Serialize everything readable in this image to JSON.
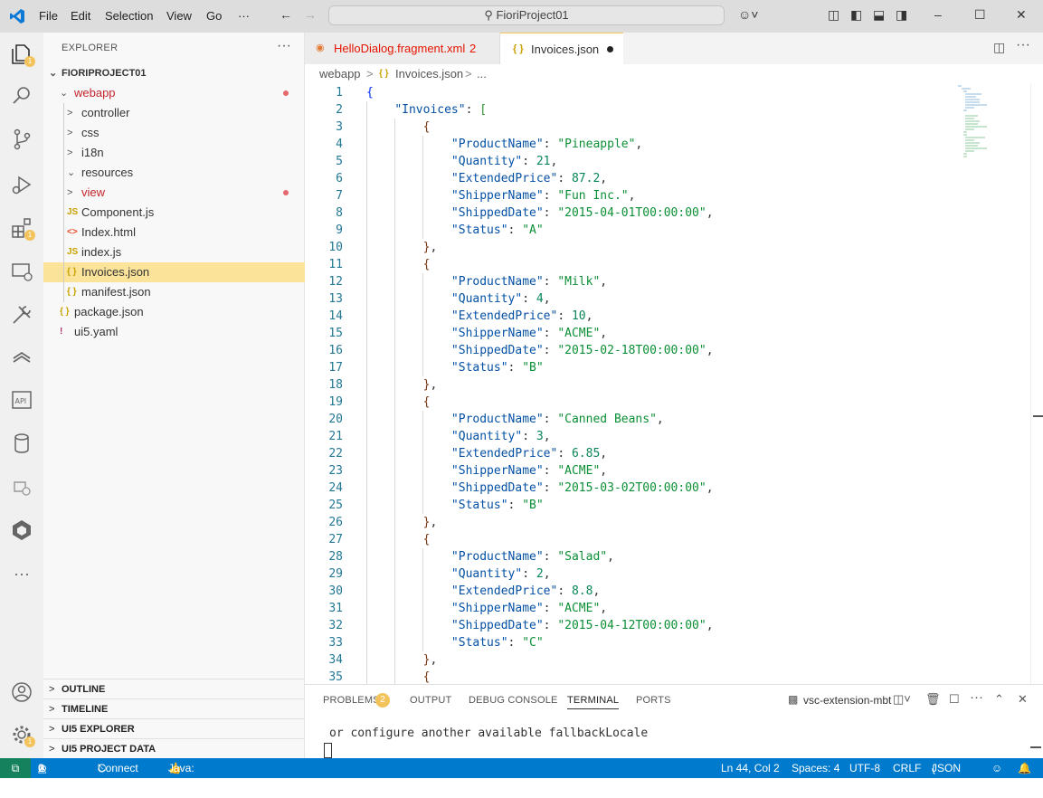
{
  "titlebar": {
    "menus": [
      "File",
      "Edit",
      "Selection",
      "View",
      "Go",
      "···"
    ],
    "search": "FioriProject01"
  },
  "sidebar": {
    "title": "EXPLORER",
    "project": "FIORIPROJECT01",
    "tree": [
      {
        "label": "webapp",
        "type": "folder-open",
        "depth": 1,
        "dot": true
      },
      {
        "label": "controller",
        "type": "folder",
        "depth": 2
      },
      {
        "label": "css",
        "type": "folder",
        "depth": 2
      },
      {
        "label": "i18n",
        "type": "folder",
        "depth": 2
      },
      {
        "label": "resources",
        "type": "folder-open",
        "depth": 2
      },
      {
        "label": "view",
        "type": "folder",
        "depth": 2,
        "dot": true
      },
      {
        "label": "Component.js",
        "type": "js",
        "depth": 2
      },
      {
        "label": "Index.html",
        "type": "html",
        "depth": 2
      },
      {
        "label": "index.js",
        "type": "js",
        "depth": 2
      },
      {
        "label": "Invoices.json",
        "type": "json",
        "depth": 2,
        "selected": true
      },
      {
        "label": "manifest.json",
        "type": "json",
        "depth": 2
      },
      {
        "label": "package.json",
        "type": "json",
        "depth": 1
      },
      {
        "label": "ui5.yaml",
        "type": "yaml",
        "depth": 1
      }
    ],
    "panels": [
      "OUTLINE",
      "TIMELINE",
      "UI5 EXPLORER",
      "UI5 PROJECT DATA"
    ]
  },
  "tabs": [
    {
      "label": "HelloDialog.fragment.xml",
      "badge": "2",
      "active": false
    },
    {
      "label": "Invoices.json",
      "active": true
    }
  ],
  "breadcrumb": {
    "folder": "webapp",
    "file": "Invoices.json",
    "more": "..."
  },
  "editor": {
    "start_line": 1,
    "lines": [
      [
        [
          "{",
          "b1"
        ]
      ],
      [
        [
          "    "
        ],
        [
          "\"Invoices\"",
          "k"
        ],
        [
          ": "
        ],
        [
          "[",
          "b2"
        ]
      ],
      [
        [
          "        "
        ],
        [
          "{",
          "b3"
        ]
      ],
      [
        [
          "            "
        ],
        [
          "\"ProductName\"",
          "k"
        ],
        [
          ": "
        ],
        [
          "\"Pineapple\"",
          "s"
        ],
        [
          ","
        ]
      ],
      [
        [
          "            "
        ],
        [
          "\"Quantity\"",
          "k"
        ],
        [
          ": "
        ],
        [
          "21",
          "n"
        ],
        [
          ","
        ]
      ],
      [
        [
          "            "
        ],
        [
          "\"ExtendedPrice\"",
          "k"
        ],
        [
          ": "
        ],
        [
          "87.2",
          "n"
        ],
        [
          ","
        ]
      ],
      [
        [
          "            "
        ],
        [
          "\"ShipperName\"",
          "k"
        ],
        [
          ": "
        ],
        [
          "\"Fun Inc.\"",
          "s"
        ],
        [
          ","
        ]
      ],
      [
        [
          "            "
        ],
        [
          "\"ShippedDate\"",
          "k"
        ],
        [
          ": "
        ],
        [
          "\"2015-04-01T00:00:00\"",
          "s"
        ],
        [
          ","
        ]
      ],
      [
        [
          "            "
        ],
        [
          "\"Status\"",
          "k"
        ],
        [
          ": "
        ],
        [
          "\"A\"",
          "s"
        ]
      ],
      [
        [
          "        "
        ],
        [
          "}",
          "b3"
        ],
        [
          ","
        ]
      ],
      [
        [
          "        "
        ],
        [
          "{",
          "b3"
        ]
      ],
      [
        [
          "            "
        ],
        [
          "\"ProductName\"",
          "k"
        ],
        [
          ": "
        ],
        [
          "\"Milk\"",
          "s"
        ],
        [
          ","
        ]
      ],
      [
        [
          "            "
        ],
        [
          "\"Quantity\"",
          "k"
        ],
        [
          ": "
        ],
        [
          "4",
          "n"
        ],
        [
          ","
        ]
      ],
      [
        [
          "            "
        ],
        [
          "\"ExtendedPrice\"",
          "k"
        ],
        [
          ": "
        ],
        [
          "10",
          "n"
        ],
        [
          ","
        ]
      ],
      [
        [
          "            "
        ],
        [
          "\"ShipperName\"",
          "k"
        ],
        [
          ": "
        ],
        [
          "\"ACME\"",
          "s"
        ],
        [
          ","
        ]
      ],
      [
        [
          "            "
        ],
        [
          "\"ShippedDate\"",
          "k"
        ],
        [
          ": "
        ],
        [
          "\"2015-02-18T00:00:00\"",
          "s"
        ],
        [
          ","
        ]
      ],
      [
        [
          "            "
        ],
        [
          "\"Status\"",
          "k"
        ],
        [
          ": "
        ],
        [
          "\"B\"",
          "s"
        ]
      ],
      [
        [
          "        "
        ],
        [
          "}",
          "b3"
        ],
        [
          ","
        ]
      ],
      [
        [
          "        "
        ],
        [
          "{",
          "b3"
        ]
      ],
      [
        [
          "            "
        ],
        [
          "\"ProductName\"",
          "k"
        ],
        [
          ": "
        ],
        [
          "\"Canned Beans\"",
          "s"
        ],
        [
          ","
        ]
      ],
      [
        [
          "            "
        ],
        [
          "\"Quantity\"",
          "k"
        ],
        [
          ": "
        ],
        [
          "3",
          "n"
        ],
        [
          ","
        ]
      ],
      [
        [
          "            "
        ],
        [
          "\"ExtendedPrice\"",
          "k"
        ],
        [
          ": "
        ],
        [
          "6.85",
          "n"
        ],
        [
          ","
        ]
      ],
      [
        [
          "            "
        ],
        [
          "\"ShipperName\"",
          "k"
        ],
        [
          ": "
        ],
        [
          "\"ACME\"",
          "s"
        ],
        [
          ","
        ]
      ],
      [
        [
          "            "
        ],
        [
          "\"ShippedDate\"",
          "k"
        ],
        [
          ": "
        ],
        [
          "\"2015-03-02T00:00:00\"",
          "s"
        ],
        [
          ","
        ]
      ],
      [
        [
          "            "
        ],
        [
          "\"Status\"",
          "k"
        ],
        [
          ": "
        ],
        [
          "\"B\"",
          "s"
        ]
      ],
      [
        [
          "        "
        ],
        [
          "}",
          "b3"
        ],
        [
          ","
        ]
      ],
      [
        [
          "        "
        ],
        [
          "{",
          "b3"
        ]
      ],
      [
        [
          "            "
        ],
        [
          "\"ProductName\"",
          "k"
        ],
        [
          ": "
        ],
        [
          "\"Salad\"",
          "s"
        ],
        [
          ","
        ]
      ],
      [
        [
          "            "
        ],
        [
          "\"Quantity\"",
          "k"
        ],
        [
          ": "
        ],
        [
          "2",
          "n"
        ],
        [
          ","
        ]
      ],
      [
        [
          "            "
        ],
        [
          "\"ExtendedPrice\"",
          "k"
        ],
        [
          ": "
        ],
        [
          "8.8",
          "n"
        ],
        [
          ","
        ]
      ],
      [
        [
          "            "
        ],
        [
          "\"ShipperName\"",
          "k"
        ],
        [
          ": "
        ],
        [
          "\"ACME\"",
          "s"
        ],
        [
          ","
        ]
      ],
      [
        [
          "            "
        ],
        [
          "\"ShippedDate\"",
          "k"
        ],
        [
          ": "
        ],
        [
          "\"2015-04-12T00:00:00\"",
          "s"
        ],
        [
          ","
        ]
      ],
      [
        [
          "            "
        ],
        [
          "\"Status\"",
          "k"
        ],
        [
          ": "
        ],
        [
          "\"C\"",
          "s"
        ]
      ],
      [
        [
          "        "
        ],
        [
          "}",
          "b3"
        ],
        [
          ","
        ]
      ],
      [
        [
          "        "
        ],
        [
          "{",
          "b3"
        ]
      ]
    ]
  },
  "panel": {
    "tabs": [
      "PROBLEMS",
      "OUTPUT",
      "DEBUG CONSOLE",
      "TERMINAL",
      "PORTS"
    ],
    "problems_count": "2",
    "active_tab": "TERMINAL",
    "terminal_name": "vsc-extension-mbt",
    "terminal_text": "or configure another available fallbackLocale"
  },
  "status": {
    "errors": "2",
    "warnings": "0",
    "connect": "Connect",
    "java": "Java: Ready",
    "position": "Ln 44, Col 2",
    "spaces": "Spaces: 4",
    "encoding": "UTF-8",
    "eol": "CRLF",
    "language": "JSON"
  },
  "colors": {
    "accent": "#007acc",
    "selection": "#fbe39a",
    "string": "#0b8f35",
    "key": "#0451a5",
    "number": "#098658"
  }
}
